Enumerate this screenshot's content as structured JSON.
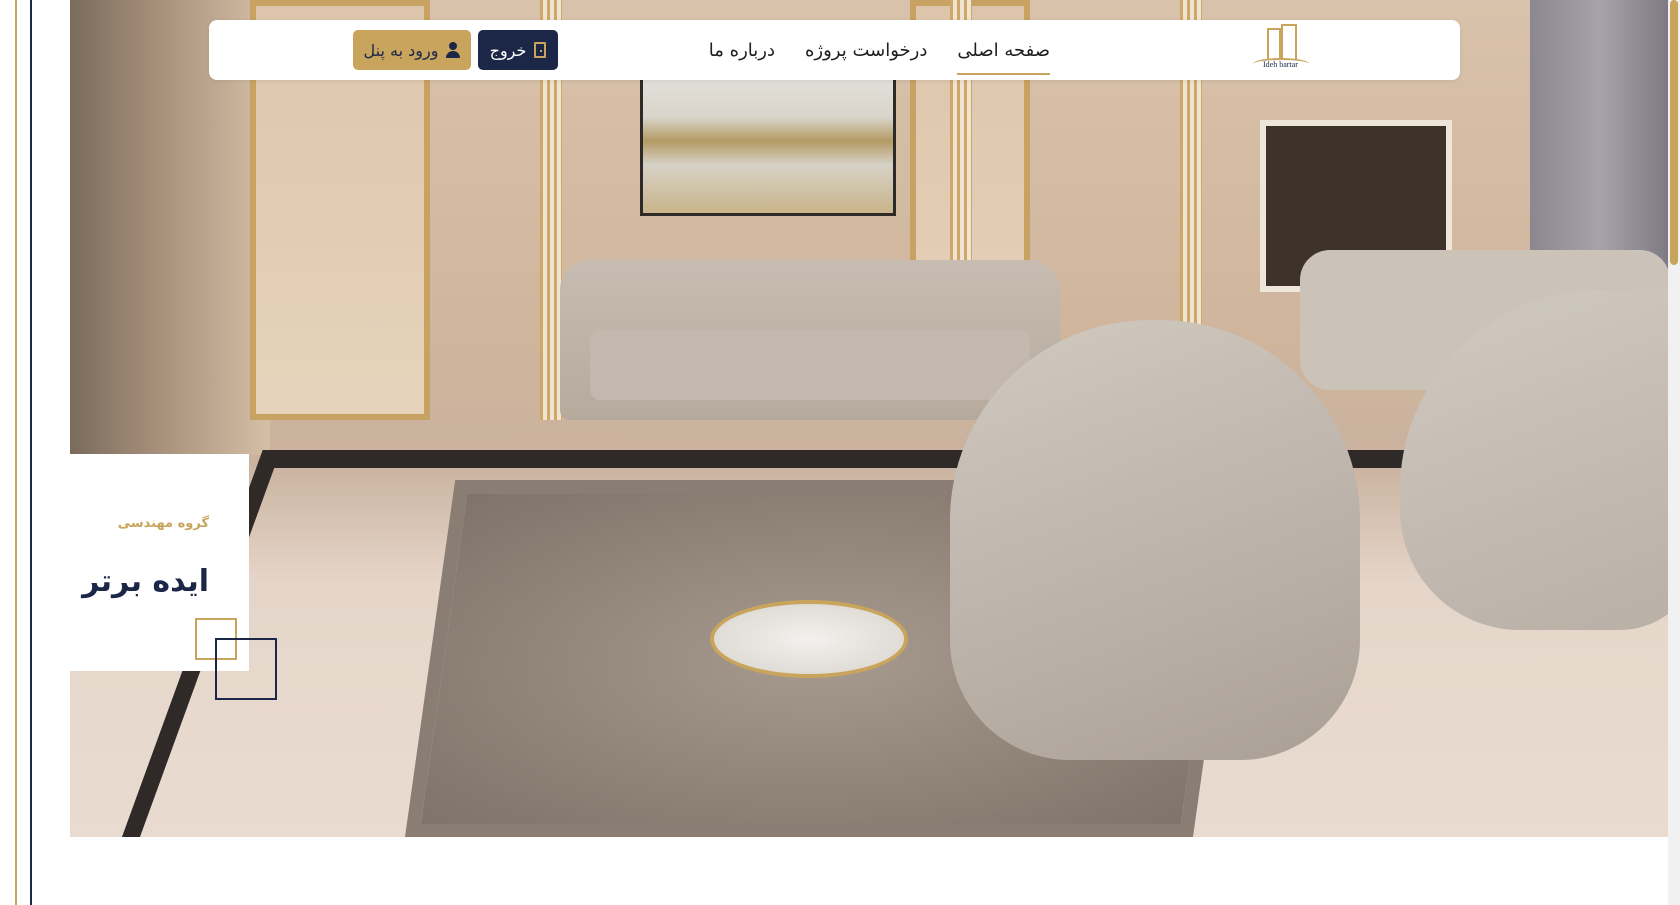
{
  "brand": {
    "logo_text": "Ideh bartar",
    "accent_gold": "#c9a45c",
    "navy": "#1c2647"
  },
  "nav": {
    "links": [
      {
        "label": "صفحه اصلی",
        "active": true
      },
      {
        "label": "درخواست پروژه",
        "active": false
      },
      {
        "label": "درباره ما",
        "active": false
      }
    ],
    "exit_label": "خروج",
    "panel_label": "ورود به پنل"
  },
  "hero": {
    "subtitle": "گروه مهندسی",
    "title": "ایده برتر"
  },
  "icons": [
    "door-icon",
    "user-icon",
    "logo-icon"
  ]
}
